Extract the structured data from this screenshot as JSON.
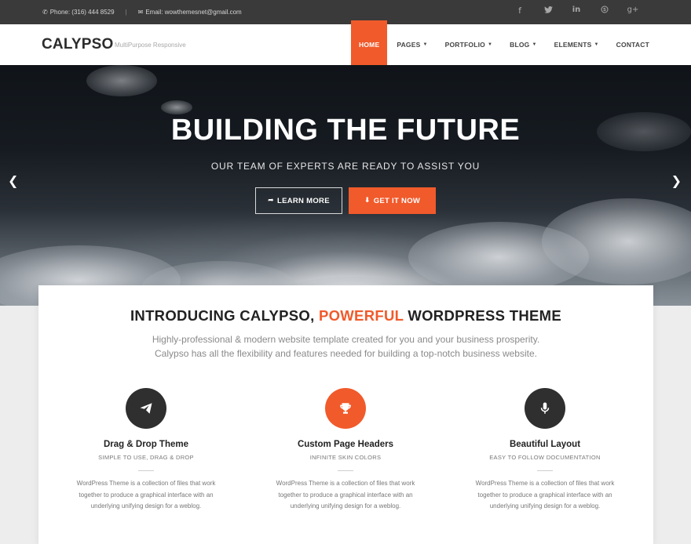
{
  "topbar": {
    "phone": "Phone: (316) 444 8529",
    "separator": "|",
    "email": "Email: wowthemesnet@gmail.com",
    "social_icons": [
      "facebook-icon",
      "twitter-icon",
      "linkedin-icon",
      "skype-icon",
      "google-plus-icon"
    ]
  },
  "nav": {
    "logo": "CALYPSO",
    "tagline": "MultiPurpose Responsive",
    "items": [
      {
        "label": "HOME",
        "active": true,
        "dropdown": false
      },
      {
        "label": "PAGES",
        "active": false,
        "dropdown": true
      },
      {
        "label": "PORTFOLIO",
        "active": false,
        "dropdown": true
      },
      {
        "label": "BLOG",
        "active": false,
        "dropdown": true
      },
      {
        "label": "ELEMENTS",
        "active": false,
        "dropdown": true
      },
      {
        "label": "CONTACT",
        "active": false,
        "dropdown": false
      }
    ]
  },
  "hero": {
    "title": "BUILDING THE FUTURE",
    "subtitle": "OUR TEAM OF EXPERTS ARE READY TO ASSIST YOU",
    "learn_more": "LEARN MORE",
    "get_it_now": "GET IT NOW"
  },
  "intro": {
    "title_before": "INTRODUCING CALYPSO, ",
    "title_highlight": "POWERFUL",
    "title_after": " WORDPRESS THEME",
    "text_line1": "Highly-professional & modern website template created for you and your business prosperity.",
    "text_line2": "Calypso has all the flexibility and features needed for building a top-notch business website."
  },
  "features": [
    {
      "icon": "paper-plane-icon",
      "title": "Drag & Drop Theme",
      "subtitle": "SIMPLE TO USE, DRAG & DROP",
      "text": "WordPress Theme is a collection of files that work together to produce a graphical interface with an underlying unifying design for a weblog."
    },
    {
      "icon": "trophy-icon",
      "title": "Custom Page Headers",
      "subtitle": "INFINITE SKIN COLORS",
      "text": "WordPress Theme is a collection of files that work together to produce a graphical interface with an underlying unifying design for a weblog."
    },
    {
      "icon": "microphone-icon",
      "title": "Beautiful Layout",
      "subtitle": "EASY TO FOLLOW DOCUMENTATION",
      "text": "WordPress Theme is a collection of files that work together to produce a graphical interface with an underlying unifying design for a weblog."
    }
  ],
  "colors": {
    "accent": "#f15a2b",
    "topbar": "#3a3a3a",
    "dark_circle": "#2f2f2f"
  }
}
